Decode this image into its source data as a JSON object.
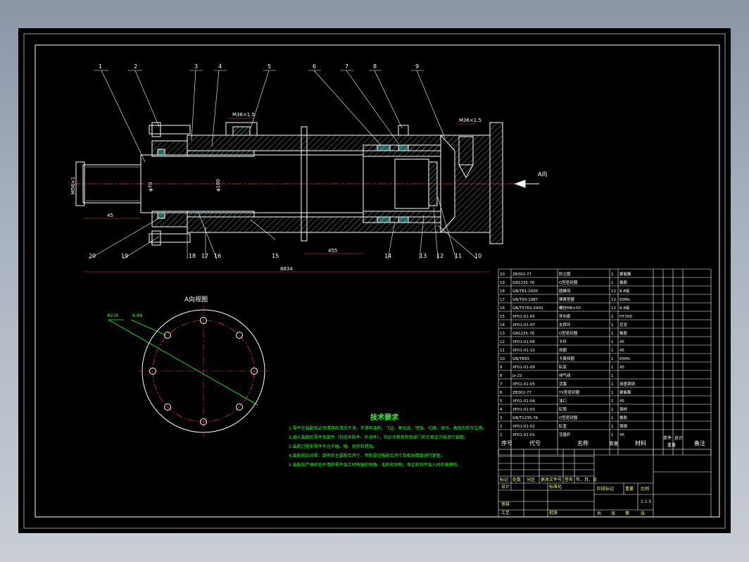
{
  "colors": {
    "background": "#000000",
    "lines": "#ffffff",
    "centerline": "#ff3030",
    "annotation": "#22ff22",
    "hatch": "#3cc4c4",
    "callout": "#ffff66",
    "dimension": "#ff4040"
  },
  "view_main": {
    "callouts": [
      "1",
      "2",
      "3",
      "4",
      "5",
      "6",
      "7",
      "8",
      "9",
      "20",
      "19",
      "18",
      "17",
      "16",
      "15",
      "14",
      "13",
      "12",
      "11",
      "10"
    ],
    "arrow_label": "A向",
    "dims": {
      "overall": "8834",
      "d1": "M36×1.5",
      "d2": "M36×1.5",
      "d3": "M36×1.5",
      "h1": "M56×1",
      "h2": "φ70",
      "h3": "φ100",
      "len1": "45",
      "len2": "455"
    }
  },
  "view_a": {
    "title": "A向视图",
    "label1": "Φ238",
    "label2": "8-Φ8"
  },
  "notes": {
    "title": "技术要求",
    "items": [
      "1.零件在装配前必须清理和清洗干净，不得有毛刺、飞边、氧化皮、锈蚀、切屑、油污、着色剂和灰尘等。",
      "2.进入装配的零件及部件（包括外购件、外协件），均必须具有检验部门的合格证方能进行装配。",
      "3.装配过程中零件不允许磕、碰、划伤和锈蚀。",
      "4.装配前应对零、部件的主要配合尺寸，特别是过盈配合尺寸及相关精度进行复查。",
      "5.装配前严格检查并清除零件加工时残留的锐角、毛刺和异物。保证密封件装入时不被擦伤。"
    ]
  },
  "bom": {
    "rows": [
      [
        "20",
        "ZB302-77",
        "防尘圈",
        "1",
        "聚氨酯"
      ],
      [
        "19",
        "GB1235-76",
        "O型密封圈",
        "1",
        "橡胶"
      ],
      [
        "18",
        "GB/T81-2000",
        "圆螺母",
        "12",
        "8.8级"
      ],
      [
        "17",
        "GB/T93-1987",
        "弹簧垫圈",
        "12",
        "65Mn"
      ],
      [
        "16",
        "GB/T5783-2000",
        "螺栓M8×50",
        "12",
        "8.8级"
      ],
      [
        "15",
        "XF01-01-05",
        "导向套",
        "1",
        "HT200"
      ],
      [
        "14",
        "XF01-01-07",
        "支撑环",
        "1",
        "尼龙"
      ],
      [
        "13",
        "GB1235-76",
        "O型密封圈",
        "1",
        "橡胶"
      ],
      [
        "12",
        "XF01-01-06",
        "卡环",
        "1",
        "45"
      ],
      [
        "11",
        "XF01-01-10",
        "挡圈",
        "1",
        "45"
      ],
      [
        "10",
        "GB/T893",
        "卡簧挡圈",
        "1",
        "65Mn"
      ],
      [
        "9",
        "XF01-01-09",
        "缸底",
        "1",
        "45"
      ],
      [
        "8",
        "Jz-22",
        "排气阀",
        "1",
        ""
      ],
      [
        "7",
        "XF01-01-05",
        "活塞",
        "1",
        "球墨铸铁"
      ],
      [
        "6",
        "ZB302-77",
        "YX型密封圈",
        "1",
        "聚氨酯"
      ],
      [
        "5",
        "XF01-01-04",
        "油口",
        "1",
        "45"
      ],
      [
        "4",
        "XF01-01-03",
        "缸筒",
        "1",
        "钢材"
      ],
      [
        "3",
        "GB/T1235-76",
        "O型密封圈",
        "1",
        "橡胶"
      ],
      [
        "2",
        "XF01-01-02",
        "缸盖",
        "1",
        "铸钢"
      ],
      [
        "1",
        "XF01-01-01",
        "活塞杆",
        "1",
        "45"
      ]
    ],
    "header": {
      "seq": "序号",
      "code": "代号",
      "name": "名称",
      "qty": "数量",
      "material": "材料",
      "unit_weight": "单件",
      "total_weight": "总计",
      "weight": "重量",
      "note": "备注"
    }
  },
  "title_block": {
    "row1": [
      "标记",
      "处数",
      "分区",
      "更改文件号",
      "签名",
      "年、月、日"
    ],
    "design": "设计",
    "standard": "标准化",
    "stage": "阶段标记",
    "weight": "重量",
    "scale_label": "比例",
    "scale": "1:1.5",
    "review": "审核",
    "process": "工艺",
    "approve": "批准",
    "sheets": [
      "共",
      "张",
      "第",
      "张"
    ]
  }
}
